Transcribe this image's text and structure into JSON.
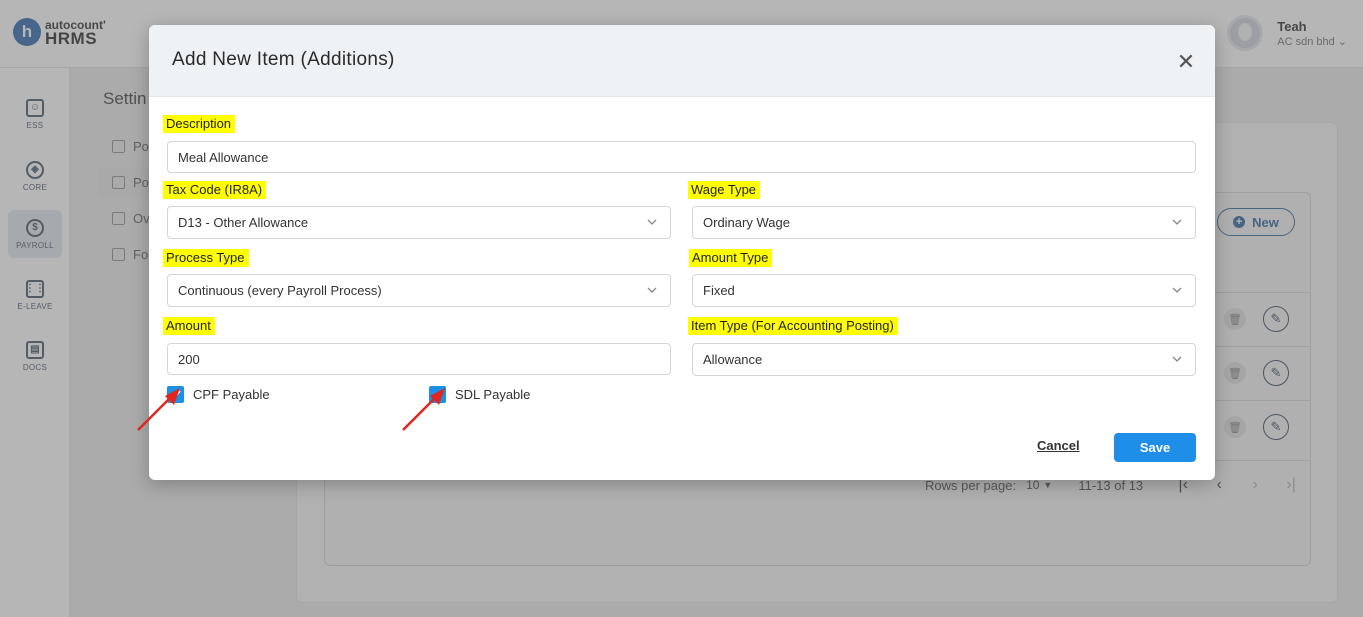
{
  "app": {
    "logo_mark": "h",
    "logo_brand": "autocount'",
    "logo_product": "HRMS",
    "user_name": "Teah",
    "user_company": "AC sdn bhd"
  },
  "sidebar": {
    "items": [
      {
        "label": "ESS",
        "icon": "person-card-icon"
      },
      {
        "label": "CORE",
        "icon": "cube-icon"
      },
      {
        "label": "PAYROLL",
        "icon": "dollar-icon"
      },
      {
        "label": "E-LEAVE",
        "icon": "calendar-icon"
      },
      {
        "label": "DOCS",
        "icon": "document-icon"
      }
    ]
  },
  "settings": {
    "title": "Settin",
    "sub_items": [
      "Po",
      "Po",
      "Ov",
      "Fo"
    ]
  },
  "table": {
    "new_label": "New",
    "rows_per_page_label": "Rows per page:",
    "rows_per_page_value": "10",
    "range": "11-13 of 13"
  },
  "dialog": {
    "title": "Add New Item (Additions)",
    "description_label": "Description",
    "description_value": "Meal Allowance",
    "tax_code_label": "Tax Code (IR8A)",
    "tax_code_value": "D13 - Other Allowance",
    "wage_type_label": "Wage Type",
    "wage_type_value": "Ordinary Wage",
    "process_type_label": "Process Type",
    "process_type_value": "Continuous (every Payroll Process)",
    "amount_type_label": "Amount Type",
    "amount_type_value": "Fixed",
    "amount_label": "Amount",
    "amount_value": "200",
    "item_type_label": "Item Type (For Accounting Posting)",
    "item_type_value": "Allowance",
    "cpf_label": "CPF Payable",
    "cpf_checked": true,
    "sdl_label": "SDL Payable",
    "sdl_checked": true,
    "cancel_label": "Cancel",
    "save_label": "Save"
  },
  "colors": {
    "highlight": "#ffff00",
    "primary": "#1e8ee8",
    "annotation_arrow": "#e0261f"
  }
}
